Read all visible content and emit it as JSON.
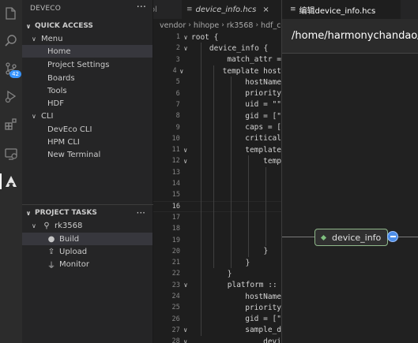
{
  "activity_bar": {
    "icons": [
      "files-icon",
      "search-icon",
      "source-control-icon",
      "run-debug-icon",
      "extensions-icon",
      "remote-explorer-icon",
      "deveco-icon"
    ],
    "source_control_badge": "42"
  },
  "sidebar": {
    "title": "DEVECO",
    "more": "···",
    "quick_access": {
      "header": "QUICK ACCESS",
      "menu": {
        "label": "Menu",
        "items": [
          "Home",
          "Project Settings",
          "Boards",
          "Tools",
          "HDF"
        ]
      },
      "cli": {
        "label": "CLI",
        "items": [
          "DevEco CLI",
          "HPM CLI",
          "New Terminal"
        ]
      }
    },
    "project_tasks": {
      "header": "PROJECT TASKS",
      "project": "rk3568",
      "tasks": [
        "Build",
        "Upload",
        "Monitor"
      ]
    }
  },
  "editor": {
    "tabs": [
      {
        "label": "ol"
      },
      {
        "label": "device_info.hcs",
        "close": "×"
      }
    ],
    "breadcrumb": [
      "vendor",
      "hihope",
      "rk3568",
      "hdf_co"
    ],
    "lines": [
      {
        "n": "1",
        "text": "root {"
      },
      {
        "n": "2",
        "text": "    device_info {"
      },
      {
        "n": "3",
        "text": "        match_attr ="
      },
      {
        "n": "4",
        "text": "        template host"
      },
      {
        "n": "5",
        "text": "            hostName"
      },
      {
        "n": "6",
        "text": "            priority"
      },
      {
        "n": "7",
        "text": "            uid = \"\""
      },
      {
        "n": "8",
        "text": "            gid = [\""
      },
      {
        "n": "9",
        "text": "            caps = ["
      },
      {
        "n": "10",
        "text": "            critical"
      },
      {
        "n": "11",
        "text": "            template"
      },
      {
        "n": "12",
        "text": "                temp"
      },
      {
        "n": "13",
        "text": ""
      },
      {
        "n": "14",
        "text": ""
      },
      {
        "n": "15",
        "text": ""
      },
      {
        "n": "16",
        "text": ""
      },
      {
        "n": "17",
        "text": ""
      },
      {
        "n": "18",
        "text": ""
      },
      {
        "n": "19",
        "text": ""
      },
      {
        "n": "20",
        "text": "                }"
      },
      {
        "n": "21",
        "text": "            }"
      },
      {
        "n": "22",
        "text": "        }"
      },
      {
        "n": "23",
        "text": "        platform ::"
      },
      {
        "n": "24",
        "text": "            hostName"
      },
      {
        "n": "25",
        "text": "            priority"
      },
      {
        "n": "26",
        "text": "            gid = [\""
      },
      {
        "n": "27",
        "text": "            sample_d"
      },
      {
        "n": "28",
        "text": "                devi"
      }
    ],
    "fold_lines": [
      "1",
      "2",
      "4",
      "11",
      "12",
      "23",
      "27",
      "28"
    ],
    "current_line": "16"
  },
  "panel": {
    "tab_label": "编辑device_info.hcs",
    "path": "/home/harmonychandao/Dev",
    "node_label": "device_info"
  }
}
